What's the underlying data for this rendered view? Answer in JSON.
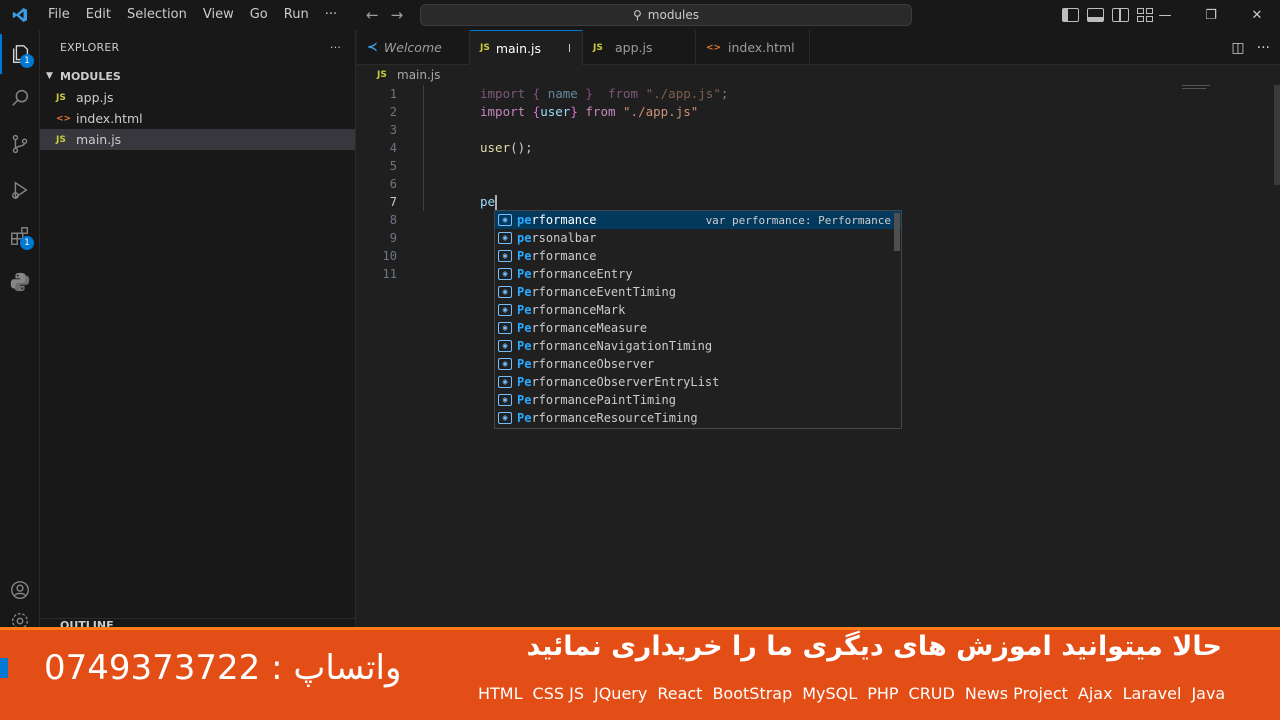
{
  "titlebar": {
    "menu": [
      "File",
      "Edit",
      "Selection",
      "View",
      "Go",
      "Run",
      "···"
    ],
    "search_text": "modules",
    "window_controls": [
      "—",
      "❐",
      "✕"
    ]
  },
  "activitybar": {
    "explorer_badge": "1",
    "extensions_badge": "1"
  },
  "sidebar": {
    "header": "EXPLORER",
    "more": "···",
    "folder": "MODULES",
    "files": [
      {
        "label": "app.js",
        "icon": "JS"
      },
      {
        "label": "index.html",
        "icon": "<>"
      },
      {
        "label": "main.js",
        "icon": "JS"
      }
    ],
    "outline": "OUTLINE"
  },
  "tabs": [
    {
      "label": "Welcome"
    },
    {
      "label": "main.js",
      "icon": "JS"
    },
    {
      "label": "app.js",
      "icon": "JS"
    },
    {
      "label": "index.html",
      "icon": "<>"
    }
  ],
  "breadcrumb": {
    "icon": "JS",
    "file": "main.js"
  },
  "editor": {
    "line_numbers": [
      "1",
      "2",
      "3",
      "4",
      "5",
      "6",
      "7",
      "8",
      "9",
      "10",
      "11"
    ],
    "current_line": 7,
    "line1": {
      "kw": "import",
      "open": " { ",
      "name": "name",
      "close": " }  ",
      "from": "from",
      "str": " \"./app.js\"",
      "end": ";"
    },
    "line2": {
      "kw": "import",
      "open": " {",
      "name": "user",
      "close": "} ",
      "from": "from",
      "str": " \"./app.js\""
    },
    "line4": {
      "fn": "user",
      "rest": "();"
    },
    "line7": "pe"
  },
  "suggest": {
    "detail": "var performance: Performance",
    "items": [
      {
        "match": "pe",
        "rest": "rformance"
      },
      {
        "match": "pe",
        "rest": "rsonalbar"
      },
      {
        "match": "Pe",
        "rest": "rformance"
      },
      {
        "match": "Pe",
        "rest": "rformanceEntry"
      },
      {
        "match": "Pe",
        "rest": "rformanceEventTiming"
      },
      {
        "match": "Pe",
        "rest": "rformanceMark"
      },
      {
        "match": "Pe",
        "rest": "rformanceMeasure"
      },
      {
        "match": "Pe",
        "rest": "rformanceNavigationTiming"
      },
      {
        "match": "Pe",
        "rest": "rformanceObserver"
      },
      {
        "match": "Pe",
        "rest": "rformanceObserverEntryList"
      },
      {
        "match": "Pe",
        "rest": "rformancePaintTiming"
      },
      {
        "match": "Pe",
        "rest": "rformanceResourceTiming"
      }
    ]
  },
  "banner": {
    "phone": "0749373722 : واتساپ",
    "promo": "حالا میتوانید اموزش های دیگری ما را خریداری نمائید",
    "techs": [
      "HTML",
      "CSS JS",
      "JQuery",
      "React",
      "BootStrap",
      "MySQL",
      "PHP",
      "CRUD",
      "News Project",
      "Ajax",
      "Laravel",
      "Java"
    ]
  }
}
